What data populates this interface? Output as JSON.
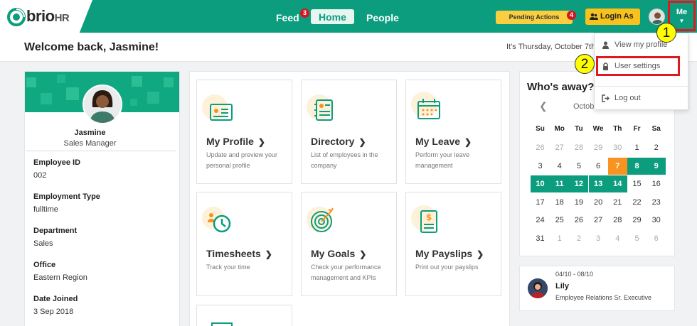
{
  "app": {
    "brand": "brio",
    "brand_suffix": "HR"
  },
  "nav": {
    "feed": "Feed",
    "feed_badge": "3",
    "home": "Home",
    "people": "People",
    "pending": "Pending Actions",
    "pending_badge": "4",
    "login_as": "Login As",
    "me": "Me"
  },
  "header": {
    "welcome": "Welcome back, Jasmine!",
    "date": "It's Thursday, October 7th"
  },
  "profile": {
    "name": "Jasmine",
    "role": "Sales Manager",
    "fields": [
      {
        "label": "Employee ID",
        "value": "002"
      },
      {
        "label": "Employment Type",
        "value": "fulltime"
      },
      {
        "label": "Department",
        "value": "Sales"
      },
      {
        "label": "Office",
        "value": "Eastern Region"
      },
      {
        "label": "Date Joined",
        "value": "3 Sep 2018"
      }
    ]
  },
  "tiles": [
    {
      "title": "My Profile",
      "desc": "Update and preview your personal profile",
      "icon": "profile-card-icon"
    },
    {
      "title": "Directory",
      "desc": "List of employees in the company",
      "icon": "directory-icon"
    },
    {
      "title": "My Leave",
      "desc": "Perform your leave management",
      "icon": "calendar-icon"
    },
    {
      "title": "Timesheets",
      "desc": "Track your time",
      "icon": "clock-icon"
    },
    {
      "title": "My Goals",
      "desc": "Check your performance management and KPIs",
      "icon": "target-icon"
    },
    {
      "title": "My Payslips",
      "desc": "Print out your payslips",
      "icon": "payslip-icon"
    }
  ],
  "whos_away": {
    "title": "Who's away?",
    "month": "October",
    "weekdays": [
      "Su",
      "Mo",
      "Tu",
      "We",
      "Th",
      "Fr",
      "Sa"
    ],
    "weeks": [
      [
        "26",
        "27",
        "28",
        "29",
        "30",
        "1",
        "2"
      ],
      [
        "3",
        "4",
        "5",
        "6",
        "7",
        "8",
        "9"
      ],
      [
        "10",
        "11",
        "12",
        "13",
        "14",
        "15",
        "16"
      ],
      [
        "17",
        "18",
        "19",
        "20",
        "21",
        "22",
        "23"
      ],
      [
        "24",
        "25",
        "26",
        "27",
        "28",
        "29",
        "30"
      ],
      [
        "31",
        "1",
        "2",
        "3",
        "4",
        "5",
        "6"
      ]
    ],
    "today": "7",
    "away_days": [
      "8",
      "9",
      "10",
      "11",
      "12",
      "13",
      "14"
    ],
    "away_person": {
      "dates": "04/10 - 08/10",
      "name": "Lily",
      "role": "Employee Relations Sr. Executive"
    }
  },
  "dropdown": {
    "view_profile": "View my profile",
    "user_settings": "User settings",
    "logout": "Log out"
  },
  "annotations": {
    "step1": "1",
    "step2": "2"
  },
  "colors": {
    "brand": "#0c9d7f",
    "pending": "#f9cf3f",
    "login_as": "#f7c21b",
    "today": "#f7931e",
    "highlight": "#e3171e"
  }
}
